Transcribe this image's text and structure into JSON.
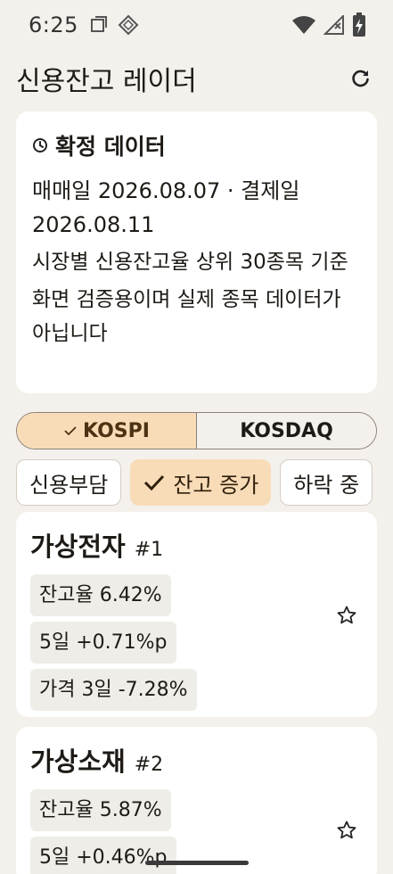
{
  "status": {
    "time": "6:25"
  },
  "app": {
    "title": "신용잔고 레이더"
  },
  "info": {
    "title": "확정 데이터",
    "line1": "매매일 2026.08.07 · 결제일",
    "line2": "2026.08.11",
    "line3": "시장별 신용잔고율 상위 30종목 기준",
    "note": "화면 검증용이며 실제 종목 데이터가 아닙니다"
  },
  "market_tabs": [
    {
      "label": "KOSPI",
      "selected": true
    },
    {
      "label": "KOSDAQ",
      "selected": false
    }
  ],
  "filters": [
    {
      "label": "신용부담",
      "selected": false
    },
    {
      "label": "잔고 증가",
      "selected": true
    },
    {
      "label": "하락 중",
      "selected": false
    }
  ],
  "stocks": [
    {
      "name": "가상전자",
      "rank": "#1",
      "metrics": [
        "잔고율 6.42%",
        "5일 +0.71%p",
        "가격 3일 -7.28%"
      ]
    },
    {
      "name": "가상소재",
      "rank": "#2",
      "metrics": [
        "잔고율 5.87%",
        "5일 +0.46%p"
      ]
    }
  ]
}
